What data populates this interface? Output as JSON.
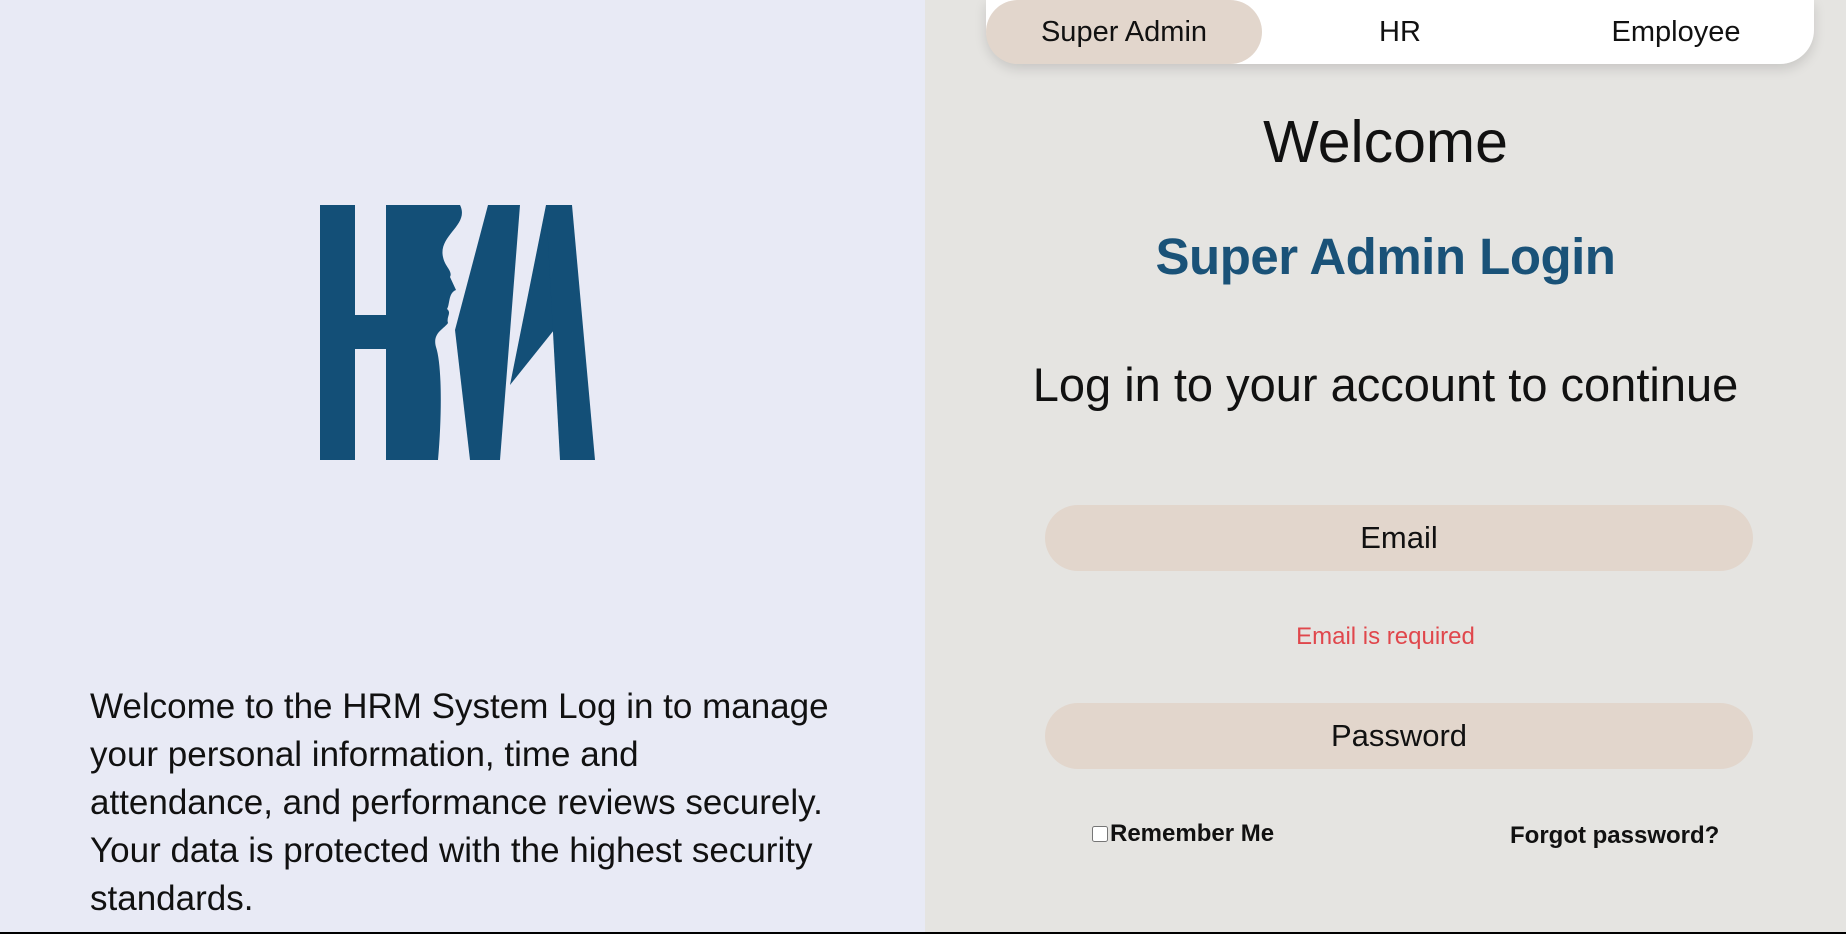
{
  "branding": {
    "logo_text": "HRM",
    "logo_color": "#134f77",
    "intro_text": "Welcome to the HRM System Log in to manage your personal information, time and attendance, and performance reviews securely. Your data is protected with the highest security standards."
  },
  "tabs": [
    {
      "label": "Super Admin",
      "active": true
    },
    {
      "label": "HR",
      "active": false
    },
    {
      "label": "Employee",
      "active": false
    }
  ],
  "login": {
    "welcome": "Welcome",
    "title": "Super Admin Login",
    "subtitle": "Log in to your account to continue",
    "email_placeholder": "Email",
    "email_value": "",
    "email_error": "Email is required",
    "password_placeholder": "Password",
    "remember_label": "Remember Me",
    "remember_checked": false,
    "forgot_label": "Forgot password?"
  },
  "colors": {
    "left_bg": "#e8eaf5",
    "right_bg": "#e5e4e1",
    "accent": "#1a5278",
    "field_bg": "#e2d6cc",
    "error": "#e0474c"
  }
}
